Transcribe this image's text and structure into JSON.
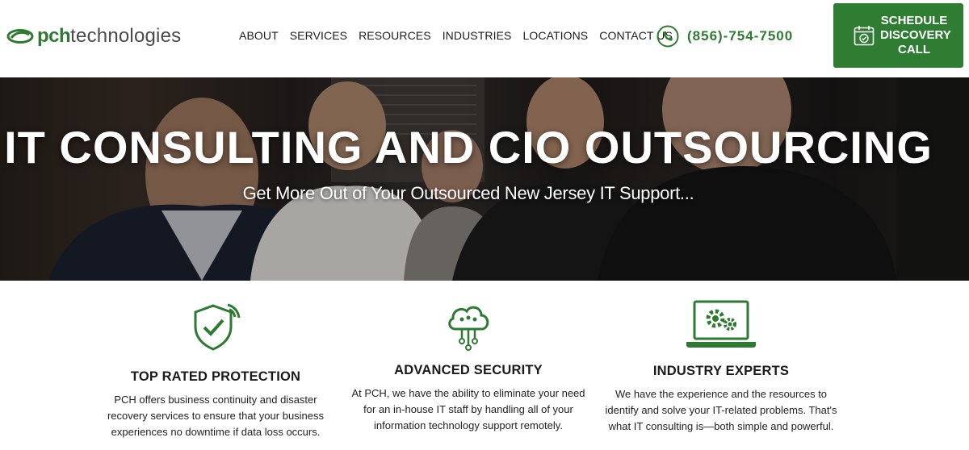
{
  "header": {
    "logo": {
      "brand": "pch",
      "suffix": "technologies"
    },
    "nav": [
      {
        "label": "ABOUT"
      },
      {
        "label": "SERVICES"
      },
      {
        "label": "RESOURCES"
      },
      {
        "label": "INDUSTRIES"
      },
      {
        "label": "LOCATIONS"
      },
      {
        "label": "CONTACT US"
      }
    ],
    "phone": "(856)-754-7500",
    "cta_label": "SCHEDULE\nDISCOVERY\nCALL"
  },
  "hero": {
    "title": "IT CONSULTING AND CIO OUTSOURCING",
    "subtitle": "Get More Out of Your Outsourced New Jersey IT Support..."
  },
  "features": [
    {
      "icon": "shield-check-icon",
      "title": "TOP RATED PROTECTION",
      "text": "PCH offers business continuity and disaster recovery services to ensure that your business experiences no downtime if data loss occurs."
    },
    {
      "icon": "cloud-network-icon",
      "title": "ADVANCED SECURITY",
      "text": "At PCH, we have the ability to eliminate your need for an in-house IT staff by handling all of your information technology support remotely."
    },
    {
      "icon": "laptop-gears-icon",
      "title": "INDUSTRY EXPERTS",
      "text": "We have the experience and the resources to identify and solve your IT-related problems. That's what IT consulting is—both simple and powerful."
    }
  ],
  "colors": {
    "brand_green": "#2f7a33",
    "cta_green": "#2e7d32",
    "text_dark": "#1a1a1a"
  }
}
